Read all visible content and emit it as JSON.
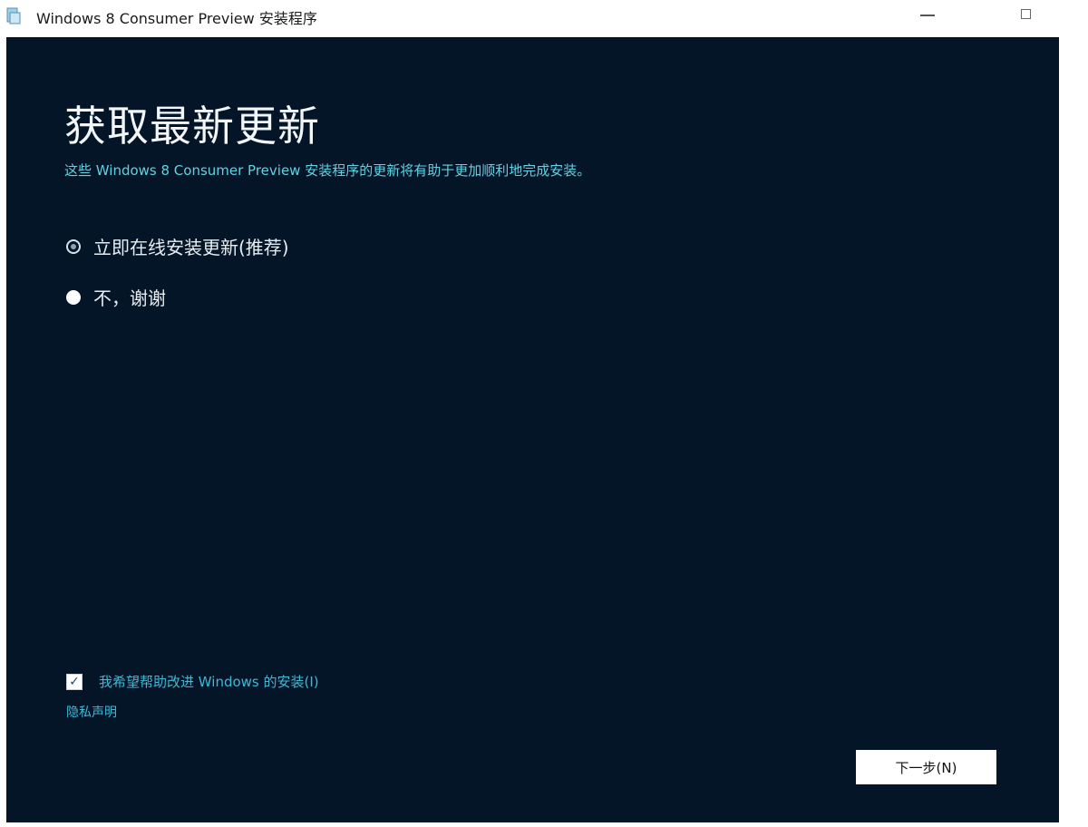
{
  "window": {
    "title": "Windows 8 Consumer Preview 安装程序",
    "icon": "setup-app-icon",
    "controls": [
      "minimize-icon",
      "maximize-icon"
    ]
  },
  "page": {
    "heading": "获取最新更新",
    "subtitle": "这些 Windows 8 Consumer Preview 安装程序的更新将有助于更加顺利地完成安装。"
  },
  "options": [
    {
      "label": "立即在线安装更新(推荐)",
      "selected": false
    },
    {
      "label": "不，谢谢",
      "selected": true
    }
  ],
  "footer": {
    "checkbox_label": "我希望帮助改进 Windows 的安装(I)",
    "checkbox_checked": true,
    "privacy_link": "隐私声明",
    "next_button": "下一步(N)"
  },
  "colors": {
    "panel_background": "#041528",
    "accent_text": "#5fd3e3"
  }
}
